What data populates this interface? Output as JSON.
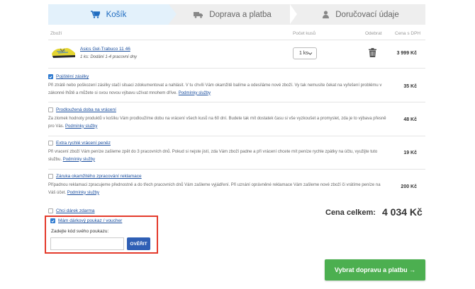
{
  "steps": [
    {
      "label": "Košík",
      "icon": "cart-icon",
      "active": true
    },
    {
      "label": "Doprava a platba",
      "icon": "truck-icon",
      "active": false
    },
    {
      "label": "Doručovací údaje",
      "icon": "user-icon",
      "active": false
    }
  ],
  "table_header": {
    "product": "Zboží",
    "quantity": "Počet kusů",
    "remove": "Odebrat",
    "price": "Cena s DPH"
  },
  "product": {
    "name": "Asics Gel-Trabuco 11 46",
    "availability": "1 ks: Dodání 1-4 pracovní dny",
    "quantity": "1 ks",
    "price": "3 999 Kč"
  },
  "services": [
    {
      "title": "Pojištění zásilky",
      "checked": true,
      "description": "Při ztrátě nebo poškození zásilky stačí situaci zdokumentovat a nahlásit. V tu chvíli Vám okamžitě balíme a odesíláme nové zboží. Vy tak nemusíte čekat na vyřešení problému v zákonné lhůtě a můžete si svou novou výbavu užívat mnohem dříve.",
      "link": "Podmínky služby",
      "price": "35 Kč"
    },
    {
      "title": "Prodloužená doba na vrácení",
      "checked": false,
      "description": "Za zlomek hodnoty produktů v košíku Vám prodloužíme dobu na vrácení všech kusů na 60 dní. Budete tak mít dostatek času si vše vyzkoušet a promyslet, zda je to výbava přesně pro Vás.",
      "link": "Podmínky služby",
      "price": "48 Kč"
    },
    {
      "title": "Extra rychlé vrácení peněz",
      "checked": false,
      "description": "Při vracení zboží Vám peníze zašleme zpět do 3 pracovních dnů. Pokud si nejste jistí, zda Vám zboží padne a při vrácení chcete mít peníze rychle zpátky na účtu, využijte tuto službu.",
      "link": "Podmínky služby",
      "price": "19 Kč"
    },
    {
      "title": "Záruka okamžitého zpracování reklamace",
      "checked": false,
      "description": "Případnou reklamaci zpracujeme přednostně a do třech pracovních dnů Vám zašleme vyjádření. Při uznání oprávněné reklamace Vám zašleme nové zboží či vrátíme peníze na Váš účet.",
      "link": "Podmínky služby",
      "price": "200 Kč"
    }
  ],
  "gift": {
    "label": "Chci dárek zdarma",
    "checked": false
  },
  "voucher": {
    "label": "Mám dárkový poukaz / voucher",
    "checked": true,
    "code_label": "Zadejte kód svého poukazu:",
    "input_value": "",
    "placeholder": "",
    "verify_label": "OVĚŘIT"
  },
  "total": {
    "label": "Cena celkem:",
    "value": "4 034 Kč"
  },
  "continue_label": "Vybrat dopravu a platbu →",
  "colors": {
    "accent": "#1f6cc0",
    "highlight": "#e43a2b",
    "continue": "#4caf50",
    "verify": "#2f5fb5"
  }
}
